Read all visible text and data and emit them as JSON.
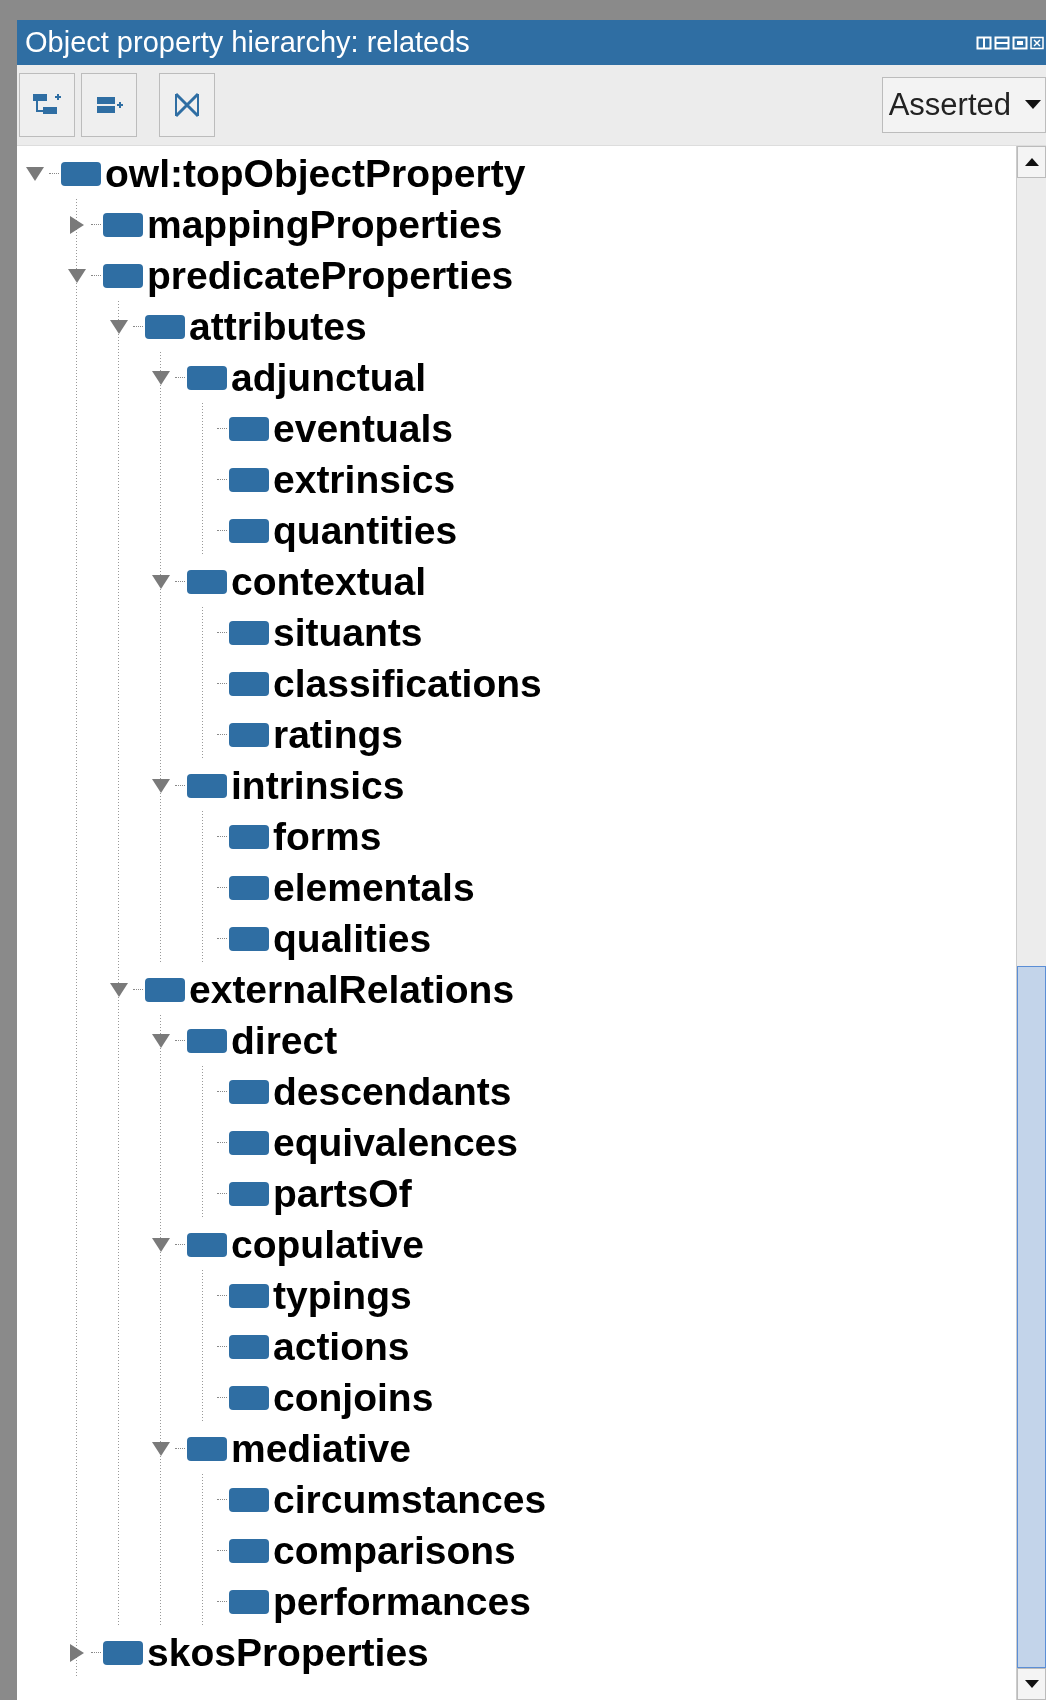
{
  "window": {
    "title": "Object property hierarchy: relateds"
  },
  "toolbar": {
    "view_select": {
      "value": "Asserted"
    }
  },
  "tree": [
    {
      "label": "owl:topObjectProperty",
      "expanded": true,
      "children": [
        {
          "label": "mappingProperties",
          "expanded": false
        },
        {
          "label": "predicateProperties",
          "expanded": true,
          "children": [
            {
              "label": "attributes",
              "expanded": true,
              "children": [
                {
                  "label": "adjunctual",
                  "expanded": true,
                  "children": [
                    {
                      "label": "eventuals"
                    },
                    {
                      "label": "extrinsics"
                    },
                    {
                      "label": "quantities"
                    }
                  ]
                },
                {
                  "label": "contextual",
                  "expanded": true,
                  "children": [
                    {
                      "label": "situants"
                    },
                    {
                      "label": "classifications"
                    },
                    {
                      "label": "ratings"
                    }
                  ]
                },
                {
                  "label": "intrinsics",
                  "expanded": true,
                  "children": [
                    {
                      "label": "forms"
                    },
                    {
                      "label": "elementals"
                    },
                    {
                      "label": "qualities"
                    }
                  ]
                }
              ]
            },
            {
              "label": "externalRelations",
              "expanded": true,
              "children": [
                {
                  "label": "direct",
                  "expanded": true,
                  "children": [
                    {
                      "label": "descendants"
                    },
                    {
                      "label": "equivalences"
                    },
                    {
                      "label": "partsOf"
                    }
                  ]
                },
                {
                  "label": "copulative",
                  "expanded": true,
                  "children": [
                    {
                      "label": "typings"
                    },
                    {
                      "label": "actions"
                    },
                    {
                      "label": "conjoins"
                    }
                  ]
                },
                {
                  "label": "mediative",
                  "expanded": true,
                  "children": [
                    {
                      "label": "circumstances"
                    },
                    {
                      "label": "comparisons"
                    },
                    {
                      "label": "performances"
                    }
                  ]
                }
              ]
            }
          ]
        },
        {
          "label": "skosProperties",
          "expanded": false
        }
      ]
    }
  ]
}
